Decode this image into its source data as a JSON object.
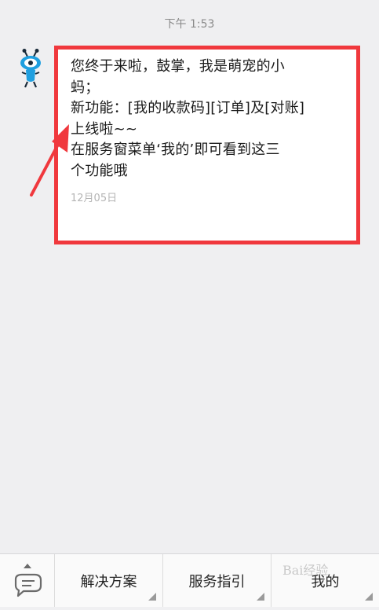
{
  "header": {
    "time": "下午 1:53"
  },
  "message": {
    "sender_icon": "ant-mascot-icon",
    "lines": [
      "您终于来啦，鼓掌，我是萌宠的小",
      "蚂；",
      "新功能：[我的收款码][订单]及[对账]",
      "上线啦~~",
      "在服务窗菜单‘我的’即可看到这三",
      "个功能哦"
    ],
    "date": "12月05日"
  },
  "annotation": {
    "frame_color": "#f0383d",
    "arrow_color": "#f0383d"
  },
  "bottom_menu": {
    "keyboard_icon": "chat-keyboard-icon",
    "items": [
      {
        "label": "解决方案"
      },
      {
        "label": "服务指引"
      },
      {
        "label": "我的"
      }
    ]
  },
  "watermark": {
    "text": "Bai经验"
  }
}
